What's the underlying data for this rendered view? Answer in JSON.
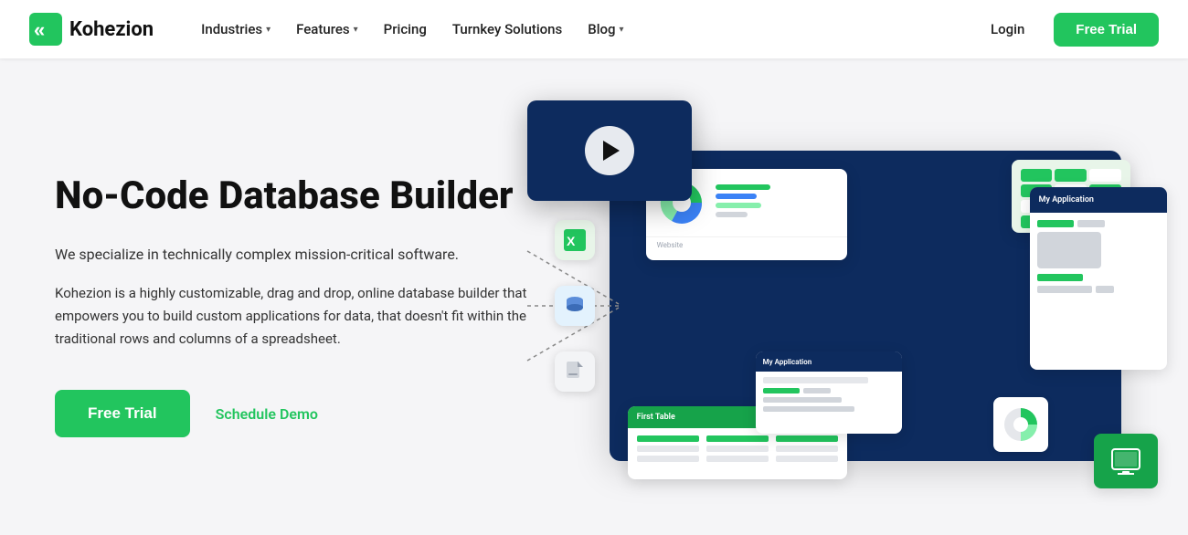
{
  "nav": {
    "logo_text": "Kohezion",
    "items": [
      {
        "label": "Industries",
        "has_dropdown": true
      },
      {
        "label": "Features",
        "has_dropdown": true
      },
      {
        "label": "Pricing",
        "has_dropdown": false
      },
      {
        "label": "Turnkey Solutions",
        "has_dropdown": false
      },
      {
        "label": "Blog",
        "has_dropdown": true
      }
    ],
    "login_label": "Login",
    "free_trial_label": "Free Trial"
  },
  "hero": {
    "title": "No-Code Database Builder",
    "sub1": "We specialize in technically complex mission-critical software.",
    "sub2": "Kohezion is a highly customizable, drag and drop, online database builder that empowers you to build custom applications for data, that doesn't fit within the traditional rows and columns of a spreadsheet.",
    "cta_primary": "Free Trial",
    "cta_secondary": "Schedule Demo"
  },
  "colors": {
    "green": "#22c55e",
    "dark_blue": "#0d2b5e",
    "nav_bg": "#ffffff"
  }
}
